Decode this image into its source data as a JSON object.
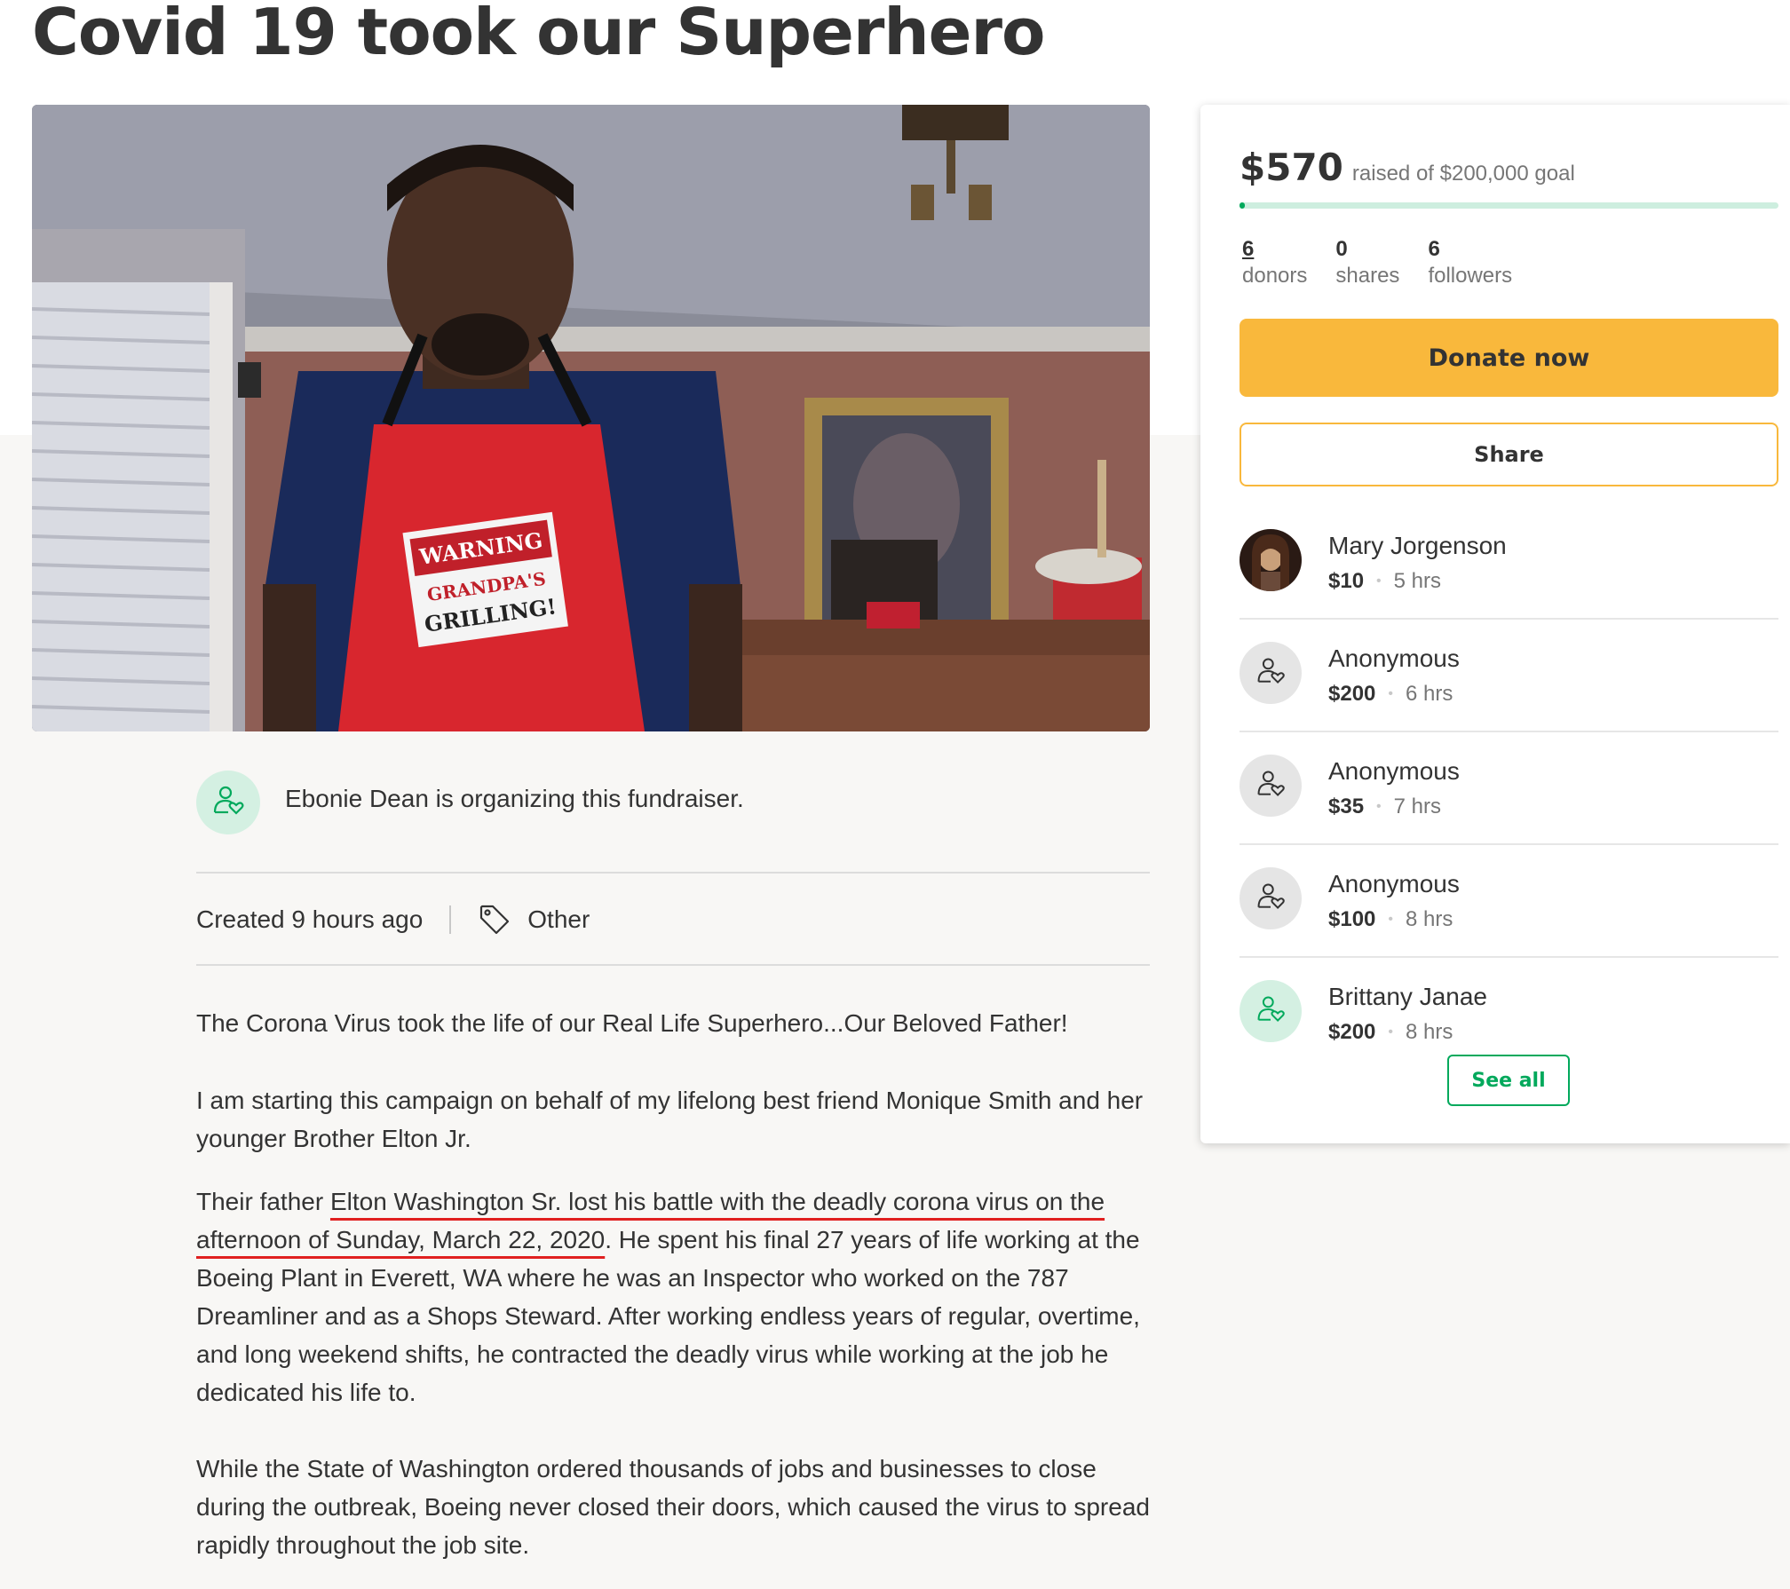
{
  "page": {
    "title": "Covid 19 took our Superhero"
  },
  "hero": {
    "apron_line1": "WARNING",
    "apron_line2": "GRANDPA'S",
    "apron_line3": "GRILLING!"
  },
  "organizer": {
    "text": "Ebonie Dean is organizing this fundraiser.",
    "icon": "user-heart-icon"
  },
  "meta": {
    "created": "Created 9 hours ago",
    "category": "Other",
    "category_icon": "tag-icon"
  },
  "story": {
    "p1": "The Corona Virus took the life of our Real Life Superhero...Our Beloved Father!",
    "p2": "I am starting this campaign on behalf of my lifelong best friend Monique Smith and her younger Brother Elton Jr.",
    "p3_start": "Their father ",
    "p3_highlight": "Elton Washington Sr. lost his battle with the deadly corona virus on the afternoon of Sunday, March 22, 2020",
    "p3_end": ". He spent his final 27 years of life working at the Boeing Plant in Everett, WA where he was an Inspector who worked on the 787 Dreamliner and as a Shops Steward. After working endless years of regular, overtime, and long weekend shifts, he contracted the deadly virus while working at the job he dedicated his life to.",
    "p4": "While the State of Washington ordered thousands of jobs and businesses to close during the outbreak, Boeing never closed their doors, which caused the virus to spread rapidly throughout the job site."
  },
  "donation": {
    "raised": "$570",
    "goal_text": "raised of $200,000 goal",
    "progress_fraction": 0.00285,
    "colors": {
      "accent_green": "#02a95c",
      "donate_yellow": "#f9b83c"
    },
    "stats": [
      {
        "num": "6",
        "label": "donors"
      },
      {
        "num": "0",
        "label": "shares"
      },
      {
        "num": "6",
        "label": "followers"
      }
    ],
    "donate_label": "Donate now",
    "share_label": "Share",
    "donors": [
      {
        "name": "Mary Jorgenson",
        "amount": "$10",
        "time": "5 hrs",
        "avatar": "photo"
      },
      {
        "name": "Anonymous",
        "amount": "$200",
        "time": "6 hrs",
        "avatar": "user-heart-icon"
      },
      {
        "name": "Anonymous",
        "amount": "$35",
        "time": "7 hrs",
        "avatar": "user-heart-icon"
      },
      {
        "name": "Anonymous",
        "amount": "$100",
        "time": "8 hrs",
        "avatar": "user-heart-icon"
      },
      {
        "name": "Brittany Janae",
        "amount": "$200",
        "time": "8 hrs",
        "avatar": "user-heart-icon-green"
      }
    ],
    "see_all_label": "See all"
  }
}
